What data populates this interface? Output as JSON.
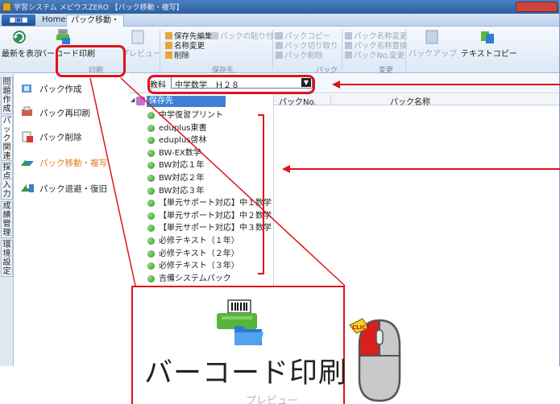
{
  "window": {
    "title": "学習システム メビウスZERO 【パック移動・複写】"
  },
  "tabs": {
    "app_button": "■□■",
    "home": "Home",
    "active": "パック移動・複写"
  },
  "ribbon": {
    "refresh_label": "最新を表示",
    "barcode_label": "バーコード印刷",
    "preview_label": "プレビュー",
    "print_group": "印刷",
    "save_edit": "保存先編集",
    "paste_pack": "パックの貼り付け",
    "rename": "名称変更",
    "delete": "削除",
    "save_group": "保存先",
    "copy_pack": "パックコピー",
    "cut_pack": "パック切り取り",
    "delete_pack": "パック削除",
    "pack_group": "パック",
    "pack_rename": "パック名称変更",
    "pack_replace": "パック名称置換",
    "pack_no_change": "パックNo.変更",
    "change_group": "変更",
    "backup_label": "バックアップ",
    "text_copy_label": "テキストコピー"
  },
  "vertical_tabs": [
    "問題作成",
    "パック関連",
    "採点入力",
    "成績管理",
    "環境設定"
  ],
  "left_menu": [
    {
      "label": "パック作成"
    },
    {
      "label": "パック再印刷"
    },
    {
      "label": "パック削除"
    },
    {
      "label": "パック移動・複写"
    },
    {
      "label": "パック退避・復旧"
    }
  ],
  "combo": {
    "label": "教科",
    "value": "中学数学　Ｈ２８"
  },
  "tree": {
    "root": "保存先",
    "items": [
      "中学復習プリント",
      "eduplus東書",
      "eduplus啓林",
      "BW-EX数学",
      "BW対応１年",
      "BW対応２年",
      "BW対応３年",
      "【単元サポート対応】中１数学",
      "【単元サポート対応】中２数学",
      "【単元サポート対応】中３数学",
      "必修テキスト（１年）",
      "必修テキスト（２年）",
      "必修テキスト（３年）",
      "吉備システムパック"
    ]
  },
  "table": {
    "col_no": "パックNo.",
    "col_name": "パック名称"
  },
  "zoom": {
    "label": "バーコード印刷",
    "cut_text": "プレビュー"
  },
  "mouse": {
    "click_text": "CLICK"
  },
  "colors": {
    "highlight": "#e0131a",
    "selection": "#3f80d6",
    "active_menu": "#e07d16"
  }
}
